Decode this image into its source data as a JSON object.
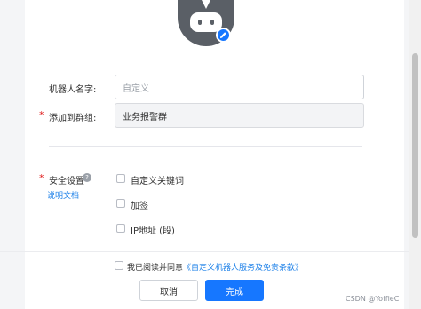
{
  "form": {
    "robot_name": {
      "label": "机器人名字:",
      "placeholder": "自定义"
    },
    "group": {
      "required_mark": "*",
      "label": "添加到群组:",
      "value": "业务报警群"
    },
    "security": {
      "required_mark": "*",
      "label": "安全设置",
      "help_icon_glyph": "?",
      "doc_link": "说明文档",
      "options": [
        {
          "label": "自定义关键词",
          "checked": false
        },
        {
          "label": "加签",
          "checked": false
        },
        {
          "label": "IP地址 (段)",
          "checked": false
        }
      ]
    }
  },
  "footer": {
    "agree_text": "我已阅读并同意",
    "agree_link": "《自定义机器人服务及免责条款》",
    "agree_checked": false,
    "cancel_label": "取消",
    "done_label": "完成"
  },
  "watermark": "CSDN @YoffieC",
  "colors": {
    "primary": "#1677ff",
    "link": "#1a7fe8",
    "required": "#e02020",
    "avatar_bg": "#5a5f66"
  },
  "icons": {
    "avatar": "robot-icon",
    "edit": "pencil-icon",
    "help": "question-icon"
  }
}
